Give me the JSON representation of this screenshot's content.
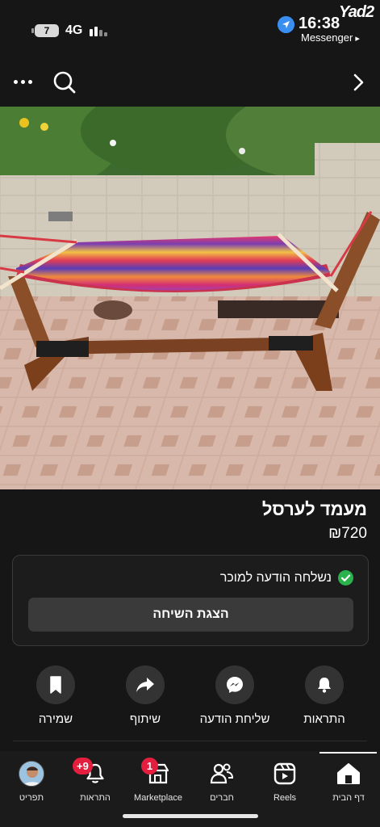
{
  "status_bar": {
    "battery": "7",
    "network": "4G",
    "time": "16:38",
    "back_app": "Messenger",
    "watermark": "Yad2"
  },
  "nav": {
    "more_icon": "more-dots-icon",
    "search_icon": "search-icon",
    "forward_icon": "chevron-right-icon"
  },
  "listing": {
    "title": "מעמד לערסל",
    "price": "₪720"
  },
  "message_card": {
    "status_text": "נשלחה הודעה למוכר",
    "view_conversation": "הצגת השיחה"
  },
  "actions": [
    {
      "label": "התראות",
      "icon": "bell-icon"
    },
    {
      "label": "שליחת הודעה",
      "icon": "messenger-icon"
    },
    {
      "label": "שיתוף",
      "icon": "share-icon"
    },
    {
      "label": "שמירה",
      "icon": "bookmark-icon"
    }
  ],
  "tabs": [
    {
      "label": "דף הבית",
      "icon": "home-icon",
      "active": true
    },
    {
      "label": "Reels",
      "icon": "reels-icon"
    },
    {
      "label": "חברים",
      "icon": "friends-icon"
    },
    {
      "label": "Marketplace",
      "icon": "marketplace-icon",
      "badge": "1"
    },
    {
      "label": "התראות",
      "icon": "bell-icon",
      "badge": "+9"
    },
    {
      "label": "תפריט",
      "icon": "avatar-icon"
    }
  ],
  "colors": {
    "background": "#161616",
    "accent_green": "#2bb24c",
    "badge_red": "#e41e3f",
    "location_blue": "#3a8ef0"
  }
}
